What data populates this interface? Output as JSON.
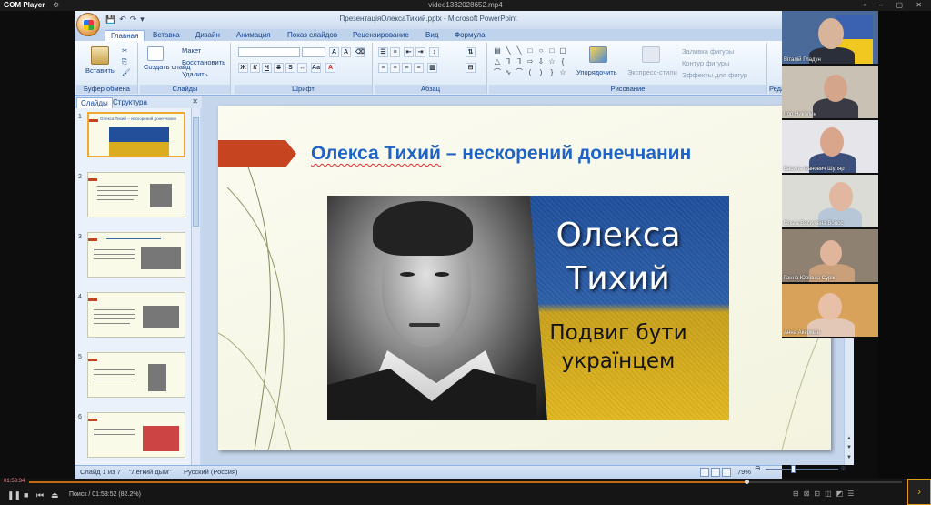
{
  "player": {
    "name": "GOM Player",
    "filename": "video1332028652.mp4",
    "current_time": "01:53:34",
    "status": "Поиск / 01:53:52 (82.2%)",
    "progress_percent": 82.2
  },
  "ppt": {
    "title": "ПрезентаціяОлексаТихий.pptx - Microsoft PowerPoint",
    "ribbon_tabs": [
      "Главная",
      "Вставка",
      "Дизайн",
      "Анимация",
      "Показ слайдов",
      "Рецензирование",
      "Вид",
      "Формула"
    ],
    "groups": {
      "clipboard": {
        "label": "Буфер обмена",
        "paste": "Вставить"
      },
      "slides": {
        "label": "Слайды",
        "new_slide": "Создать слайд",
        "layout": "Макет",
        "reset": "Восстановить",
        "delete": "Удалить"
      },
      "font": {
        "label": "Шрифт"
      },
      "paragraph": {
        "label": "Абзац"
      },
      "drawing": {
        "label": "Рисование",
        "arrange": "Упорядочить",
        "quick_styles": "Экспресс-стили",
        "fill": "Заливка фигуры",
        "outline": "Контур фигуры",
        "effects": "Эффекты для фигур"
      },
      "editing_partial": "Реда"
    },
    "pane_tabs": [
      "Слайды",
      "Структура"
    ],
    "thumbnails": [
      {
        "num": "1",
        "title": "Олекса Тихий – нескорений донеччанин"
      },
      {
        "num": "2",
        "title": ""
      },
      {
        "num": "3",
        "title": ""
      },
      {
        "num": "4",
        "title": ""
      },
      {
        "num": "5",
        "title": ""
      },
      {
        "num": "6",
        "title": ""
      }
    ],
    "slide": {
      "title_part1": "Олекса Тихий",
      "title_part2": " – нескорений донеччанин",
      "poster_name_line1": "Олекса",
      "poster_name_line2": "Тихий",
      "poster_sub_line1": "Подвиг бути",
      "poster_sub_line2": "українцем"
    },
    "statusbar": {
      "slide_counter": "Слайд 1 из 7",
      "theme": "\"Легкий дым\"",
      "language": "Русский (Россия)",
      "zoom": "79%"
    }
  },
  "participants": [
    {
      "name": "Віталій Гладун",
      "bg": "#4a6a9a",
      "skin": "#d8b49a",
      "shirt": "#2a2f3a"
    },
    {
      "name": "Ігор Николин",
      "bg": "#c9c2b4",
      "skin": "#d4a58a",
      "shirt": "#3a3a45"
    },
    {
      "name": "Василь Іванович Шуляр",
      "bg": "#e6e6ea",
      "skin": "#d9a68c",
      "shirt": "#3b4f7a"
    },
    {
      "name": "Ольга Василівна Волос",
      "bg": "#dcdcd6",
      "skin": "#e2b7a0",
      "shirt": "#b7c7d8"
    },
    {
      "name": "Ганна Юріївна Сурік",
      "bg": "#8f8172",
      "skin": "#e0b59c",
      "shirt": "#caa07a"
    },
    {
      "name": "Анна Акерман",
      "bg": "#d9a25a",
      "skin": "#e8c0a8",
      "shirt": "#e3c8b8"
    }
  ],
  "colors": {
    "slide_title": "#1f63c4",
    "accent_red": "#c64420",
    "ribbon_text": "#15428b",
    "progress": "#c46a10"
  }
}
